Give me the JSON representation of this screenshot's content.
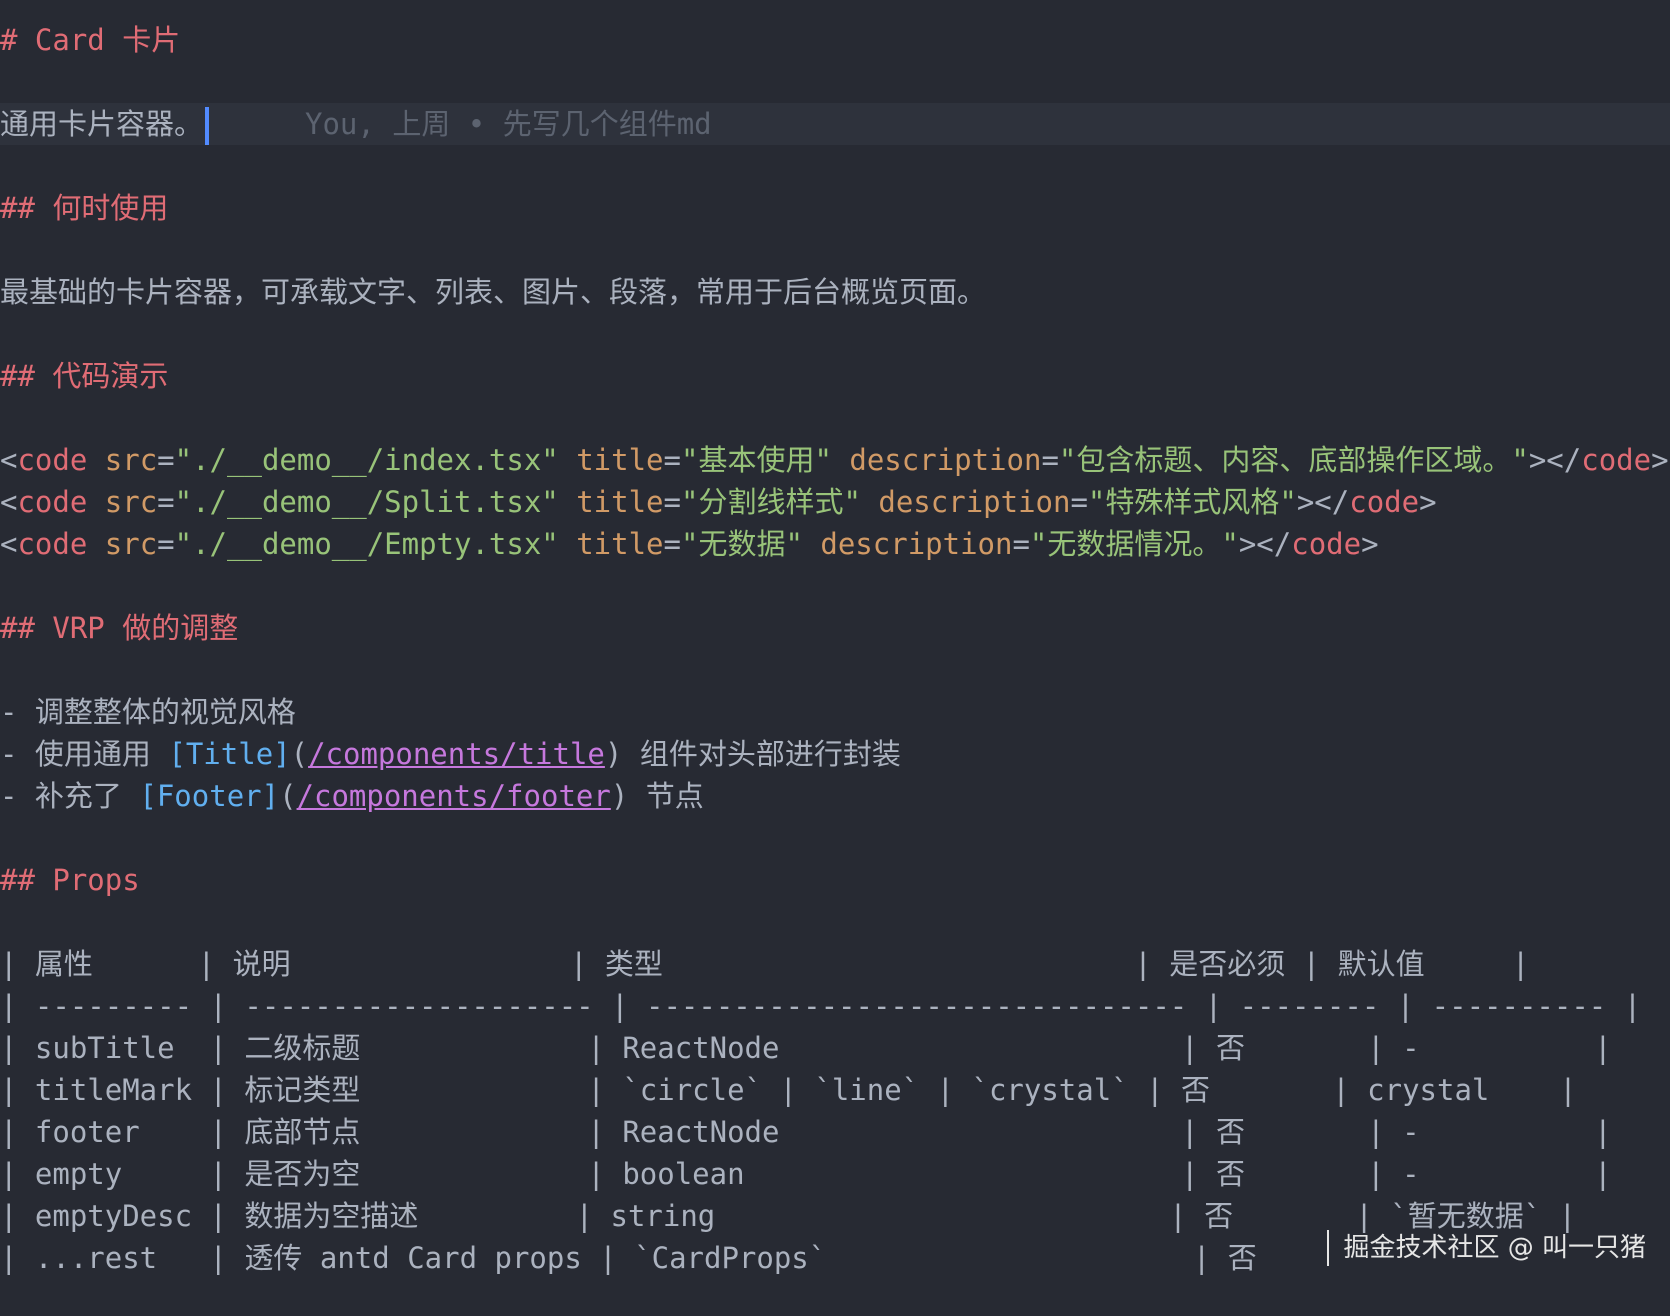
{
  "doc": {
    "h1": "# Card 卡片",
    "intro": "通用卡片容器。",
    "blame": "You, 上周 • 先写几个组件md",
    "h2_when": "## 何时使用",
    "when_text": "最基础的卡片容器，可承载文字、列表、图片、段落，常用于后台概览页面。",
    "h2_demo": "## 代码演示",
    "demos": [
      {
        "src": "\"./__demo__/index.tsx\"",
        "title": "\"基本使用\"",
        "description": "\"包含标题、内容、底部操作区域。\""
      },
      {
        "src": "\"./__demo__/Split.tsx\"",
        "title": "\"分割线样式\"",
        "description": "\"特殊样式风格\""
      },
      {
        "src": "\"./__demo__/Empty.tsx\"",
        "title": "\"无数据\"",
        "description": "\"无数据情况。\""
      }
    ],
    "h2_vrp": "## VRP 做的调整",
    "list": [
      {
        "text": "- 调整整体的视觉风格"
      },
      {
        "pre": "- 使用通用 ",
        "link_text": "[Title]",
        "link_url": "/components/title",
        "post": " 组件对头部进行封装"
      },
      {
        "pre": "- 补充了 ",
        "link_text": "[Footer]",
        "link_url": "/components/footer",
        "post": " 节点"
      }
    ],
    "h2_props": "## Props",
    "table_lines": [
      "| 属性      | 说明                | 类型                           | 是否必须 | 默认值     |",
      "| --------- | -------------------- | ------------------------------- | -------- | ---------- |",
      "| subTitle  | 二级标题             | ReactNode                       | 否       | -          |",
      "| titleMark | 标记类型             | `circle` | `line` | `crystal` | 否       | crystal    |",
      "| footer    | 底部节点             | ReactNode                       | 否       | -          |",
      "| empty     | 是否为空             | boolean                         | 否       | -          |",
      "| emptyDesc | 数据为空描述         | string                          | 否       | `暂无数据` |",
      "| ...rest   | 透传 antd Card props | `CardProps`                     | 否       "
    ]
  },
  "watermark": "掘金技术社区 @ 叫一只猪",
  "colors": {
    "background": "#272a33",
    "heading": "#e06c75",
    "string": "#98c379",
    "attribute": "#d19a66",
    "link_text": "#61afef",
    "link_url": "#c678dd",
    "cursor": "#528bff"
  }
}
